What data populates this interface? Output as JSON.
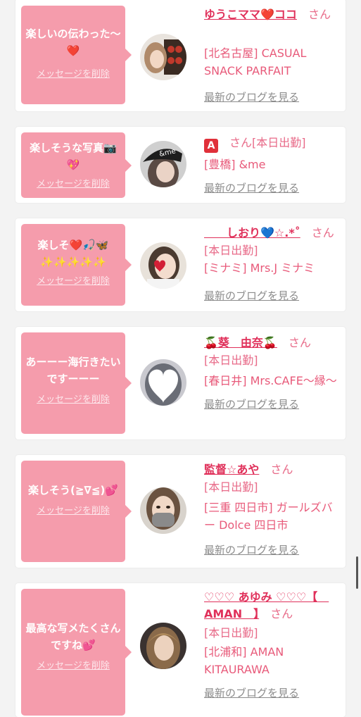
{
  "colors": {
    "accent_pink": "#f59cac",
    "name_pink": "#e0305a",
    "text_pink": "#e85a7a",
    "link_gray": "#8c8c8c"
  },
  "cards": [
    {
      "message": "楽しいの伝わった〜❤️",
      "delete_label": "メッセージを削除",
      "name": "ゆうこママ❤️ココ",
      "san": "さん",
      "status": "",
      "shop": "[北名古屋] CASUAL SNACK PARFAIT",
      "blog_label": "最新のブログを見る",
      "avatar_icon": "woman-photo-avatar"
    },
    {
      "message": "楽しそうな写真📷💖",
      "delete_label": "メッセージを削除",
      "name": "🅰️",
      "san": "さん",
      "status": "[本日出勤]",
      "shop": "[豊橋] &me",
      "blog_label": "最新のブログを見る",
      "avatar_icon": "me-hat-avatar"
    },
    {
      "message": "楽しそ❤️🎣🦋✨✨✨✨✨",
      "delete_label": "メッセージを削除",
      "name": "　　しおり💙☆.*˚",
      "san": "さん",
      "status": "[本日出勤]",
      "shop": "[ミナミ] Mrs.J ミナミ",
      "blog_label": "最新のブログを見る",
      "avatar_icon": "heart-face-avatar"
    },
    {
      "message": "あーーー海行きたいですーーー",
      "delete_label": "メッセージを削除",
      "name": "🍒葵　由奈🍒",
      "san": "さん",
      "status": "[本日出勤]",
      "shop": "[春日井] Mrs.CAFE〜縁〜",
      "blog_label": "最新のブログを見る",
      "avatar_icon": "heart-mask-avatar"
    },
    {
      "message": "楽しそう(≧∇≦)💕",
      "delete_label": "メッセージを削除",
      "name": "監督☆あや",
      "san": "さん",
      "status": "[本日出勤]",
      "shop": "[三重 四日市] ガールズバー Dolce 四日市",
      "blog_label": "最新のブログを見る",
      "avatar_icon": "mask-woman-avatar"
    },
    {
      "message": "最高な写メたくさんですね💕",
      "delete_label": "メッセージを削除",
      "name": "♡♡♡ あゆみ ♡♡♡【　AMAN　】",
      "san": "さん",
      "status": "[本日出勤]",
      "shop": "[北浦和] AMAN KITAURAWA",
      "blog_label": "最新のブログを見る",
      "avatar_icon": "blonde-woman-avatar"
    }
  ]
}
